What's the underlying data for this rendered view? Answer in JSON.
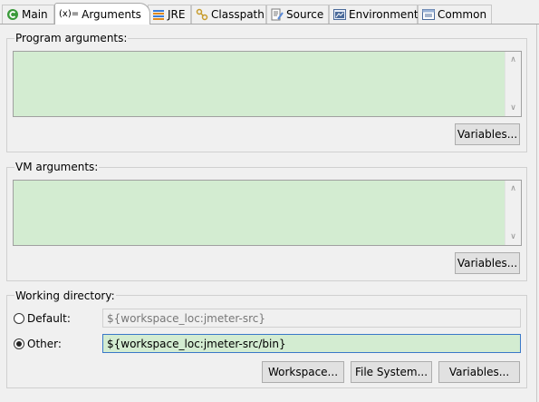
{
  "tabs": [
    {
      "label": "Main",
      "icon": "main-icon"
    },
    {
      "label": "Arguments",
      "prefix": "(x)=",
      "icon": "arguments-icon"
    },
    {
      "label": "JRE",
      "icon": "jre-icon"
    },
    {
      "label": "Classpath",
      "icon": "classpath-icon"
    },
    {
      "label": "Source",
      "icon": "source-icon"
    },
    {
      "label": "Environment",
      "icon": "environment-icon"
    },
    {
      "label": "Common",
      "icon": "common-icon"
    }
  ],
  "program_args": {
    "title": "Program arguments:",
    "value": "",
    "variables_button": "Variables..."
  },
  "vm_args": {
    "title": "VM arguments:",
    "value": "",
    "variables_button": "Variables..."
  },
  "working_dir": {
    "title": "Working directory:",
    "default_label": "Default:",
    "default_value": "${workspace_loc:jmeter-src}",
    "other_label": "Other:",
    "other_value": "${workspace_loc:jmeter-src/bin}",
    "selected": "other",
    "workspace_button": "Workspace...",
    "filesystem_button": "File System...",
    "variables_button": "Variables..."
  },
  "colors": {
    "field_bg": "#d3ecd1",
    "window_bg": "#f0f0f0"
  }
}
